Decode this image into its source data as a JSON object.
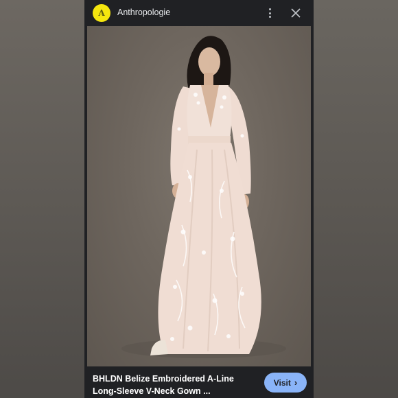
{
  "header": {
    "logo_letter": "A",
    "site_name": "Anthropologie",
    "more_icon": "more-vert-icon",
    "close_icon": "close-icon"
  },
  "image": {
    "alt": "Woman wearing embroidered long-sleeve V-neck gown"
  },
  "caption": {
    "line1": "BHLDN Belize Embroidered A-Line",
    "line2": "Long-Sleeve V-Neck Gown ..."
  },
  "visit": {
    "label": "Visit",
    "chevron": "›"
  },
  "colors": {
    "panel_bg": "#202124",
    "logo_bg": "#f5e60e",
    "visit_bg": "#8ab4f8",
    "text": "#ffffff"
  }
}
